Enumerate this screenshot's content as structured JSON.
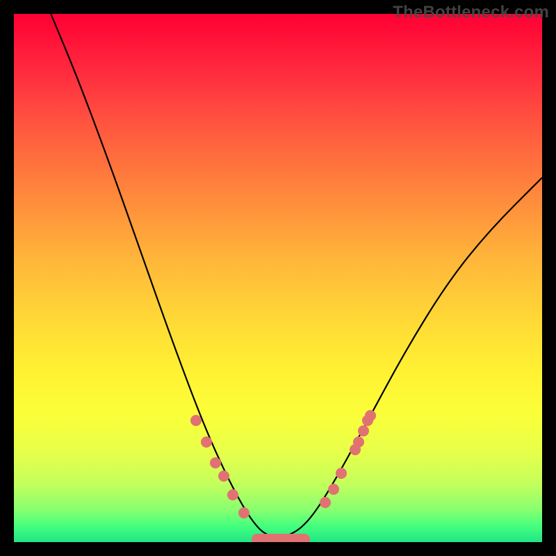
{
  "watermark": "TheBottleneck.com",
  "colors": {
    "background": "#000000",
    "marker": "#e07272",
    "curve": "#000000"
  },
  "chart_data": {
    "type": "line",
    "title": "",
    "xlabel": "",
    "ylabel": "",
    "xlim": [
      0,
      100
    ],
    "ylim": [
      0,
      100
    ],
    "grid": false,
    "curve": [
      {
        "x": 7,
        "y": 100
      },
      {
        "x": 12,
        "y": 88
      },
      {
        "x": 18,
        "y": 72
      },
      {
        "x": 24,
        "y": 55
      },
      {
        "x": 30,
        "y": 38
      },
      {
        "x": 36,
        "y": 22
      },
      {
        "x": 41,
        "y": 11
      },
      {
        "x": 45,
        "y": 4
      },
      {
        "x": 48,
        "y": 1
      },
      {
        "x": 52,
        "y": 1
      },
      {
        "x": 56,
        "y": 4
      },
      {
        "x": 61,
        "y": 12
      },
      {
        "x": 67,
        "y": 23
      },
      {
        "x": 74,
        "y": 36
      },
      {
        "x": 82,
        "y": 49
      },
      {
        "x": 90,
        "y": 59
      },
      {
        "x": 100,
        "y": 69
      }
    ],
    "markers": [
      {
        "x": 34.5,
        "y": 23
      },
      {
        "x": 36.4,
        "y": 19
      },
      {
        "x": 38.1,
        "y": 15
      },
      {
        "x": 39.8,
        "y": 12.5
      },
      {
        "x": 41.4,
        "y": 9
      },
      {
        "x": 43.5,
        "y": 5.5
      },
      {
        "x": 59.0,
        "y": 7.5
      },
      {
        "x": 60.5,
        "y": 10
      },
      {
        "x": 62.0,
        "y": 13
      },
      {
        "x": 64.6,
        "y": 17.5
      },
      {
        "x": 65.2,
        "y": 19
      },
      {
        "x": 66.2,
        "y": 21
      },
      {
        "x": 67.0,
        "y": 23
      },
      {
        "x": 67.5,
        "y": 24
      }
    ],
    "bottom_band": {
      "x_start": 45,
      "x_end": 56,
      "y": 0.5
    }
  }
}
